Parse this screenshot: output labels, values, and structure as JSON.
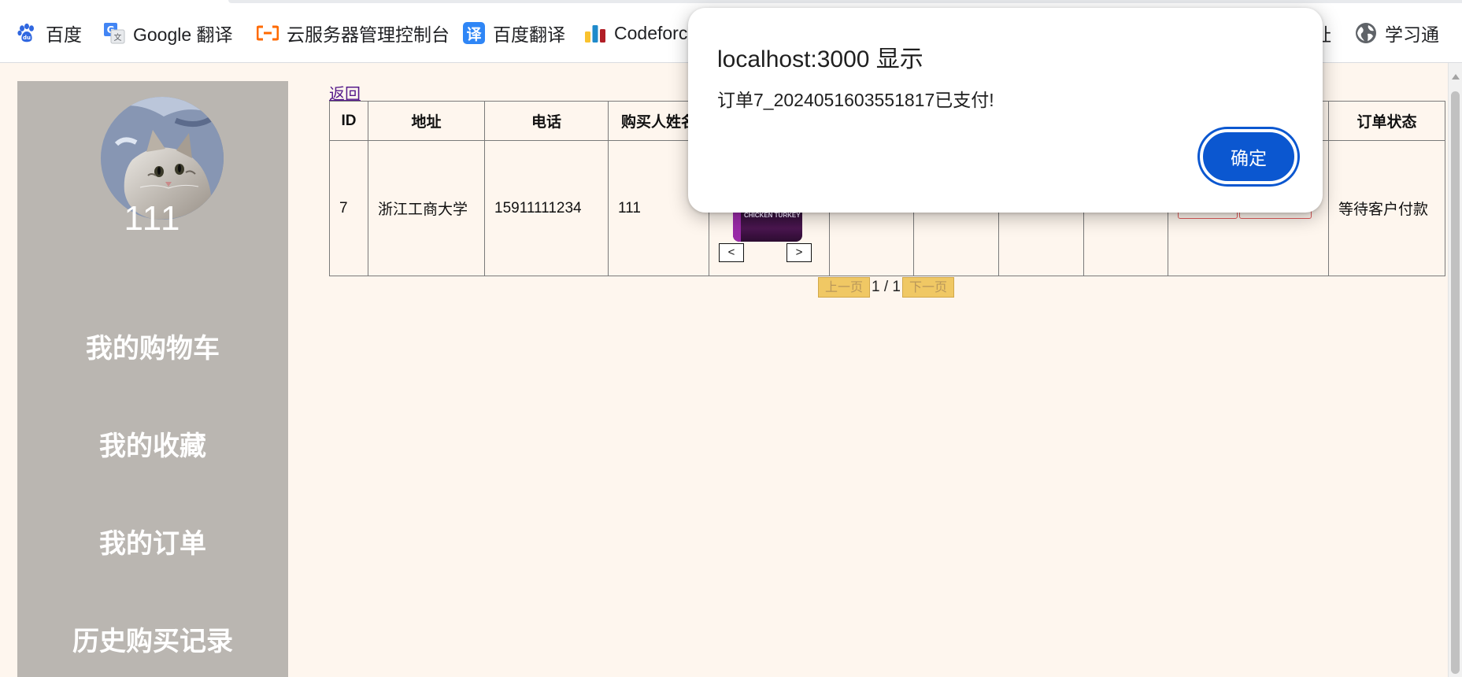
{
  "bookmarks": [
    {
      "label": "百度",
      "icon": "baidu-paw-icon"
    },
    {
      "label": "Google 翻译",
      "icon": "google-translate-icon"
    },
    {
      "label": "云服务器管理控制台",
      "icon": "aliyun-icon"
    },
    {
      "label": "百度翻译",
      "icon": "baidu-translate-icon",
      "glyph": "译"
    },
    {
      "label": "Codeforc",
      "icon": "codeforces-icon"
    },
    {
      "label": "址",
      "icon": ""
    },
    {
      "label": "学习通",
      "icon": "globe-icon"
    }
  ],
  "sidebar": {
    "username": "111",
    "avatar_icon": "cat-avatar-icon",
    "items": [
      {
        "label": "我的购物车"
      },
      {
        "label": "我的收藏"
      },
      {
        "label": "我的订单"
      },
      {
        "label": "历史购买记录"
      }
    ]
  },
  "content": {
    "back_label": "返回"
  },
  "table": {
    "headers": [
      "ID",
      "地址",
      "电话",
      "购买人姓名",
      "",
      "",
      "",
      "",
      "",
      "",
      "订单状态"
    ],
    "rows": [
      {
        "id": "7",
        "address": "浙江工商大学",
        "phone": "15911111234",
        "buyer": "111",
        "prev_label": "<",
        "next_label": ">",
        "product_img_text": "CHICKEN TURKEY + DUCK RECIPE",
        "status": "等待客户付款"
      }
    ]
  },
  "pagination": {
    "prev_label": "上一页",
    "page_info": "1 / 1",
    "next_label": "下一页"
  },
  "dialog": {
    "title": "localhost:3000 显示",
    "message": "订单7_2024051603551817已支付!",
    "ok_label": "确定"
  },
  "colors": {
    "page_bg": "#fef6ee",
    "sidebar_bg": "#bab6b1",
    "dialog_button": "#0b57d0",
    "pager_button": "#f0c864"
  }
}
